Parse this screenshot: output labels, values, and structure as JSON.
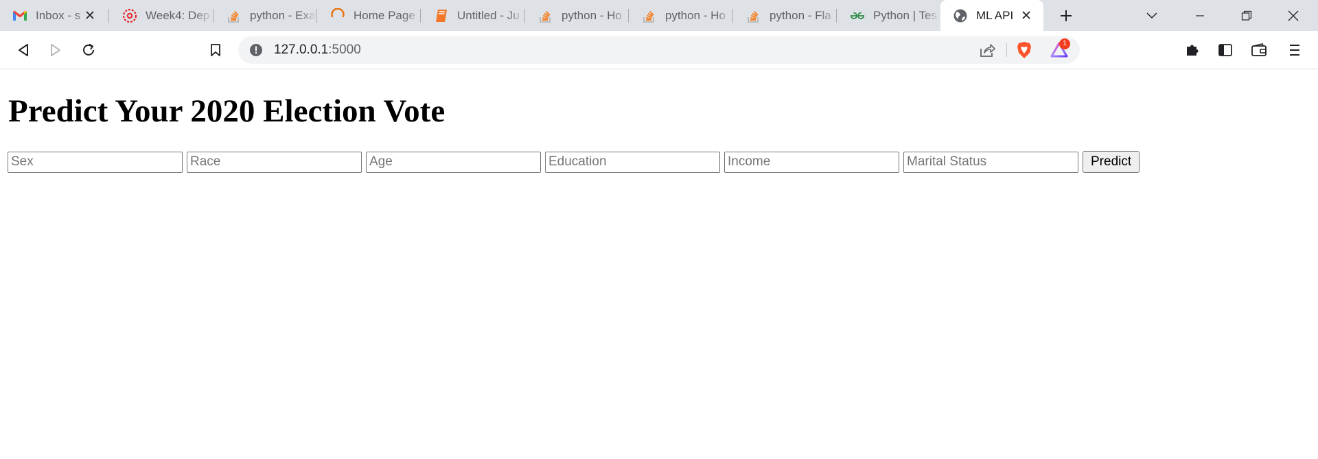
{
  "tabs": [
    {
      "title": "Inbox - s",
      "icon": "gmail-icon"
    },
    {
      "title": "Week4: Dep",
      "icon": "canvas-icon"
    },
    {
      "title": "python - Exa",
      "icon": "stackoverflow-icon"
    },
    {
      "title": "Home Page",
      "icon": "loading-spinner-icon"
    },
    {
      "title": "Untitled - Ju",
      "icon": "jupyter-book-icon"
    },
    {
      "title": "python - Ho",
      "icon": "stackoverflow-icon"
    },
    {
      "title": "python - Ho",
      "icon": "stackoverflow-icon"
    },
    {
      "title": "python - Fla",
      "icon": "stackoverflow-icon"
    },
    {
      "title": "Python | Tes",
      "icon": "geeksforgeeks-icon"
    },
    {
      "title": "ML API",
      "icon": "globe-icon",
      "active": true
    }
  ],
  "address_bar": {
    "host": "127.0.0.1",
    "port": ":5000"
  },
  "brave_rewards_badge": "1",
  "page": {
    "heading": "Predict Your 2020 Election Vote",
    "fields": [
      {
        "placeholder": "Sex",
        "value": ""
      },
      {
        "placeholder": "Race",
        "value": ""
      },
      {
        "placeholder": "Age",
        "value": ""
      },
      {
        "placeholder": "Education",
        "value": ""
      },
      {
        "placeholder": "Income",
        "value": ""
      },
      {
        "placeholder": "Marital Status",
        "value": ""
      }
    ],
    "submit_label": "Predict"
  },
  "colors": {
    "tabstrip_bg": "#dee1e6",
    "brave_orange": "#fb542b",
    "stackoverflow_orange": "#f48024",
    "gfg_green": "#2f8d46"
  }
}
